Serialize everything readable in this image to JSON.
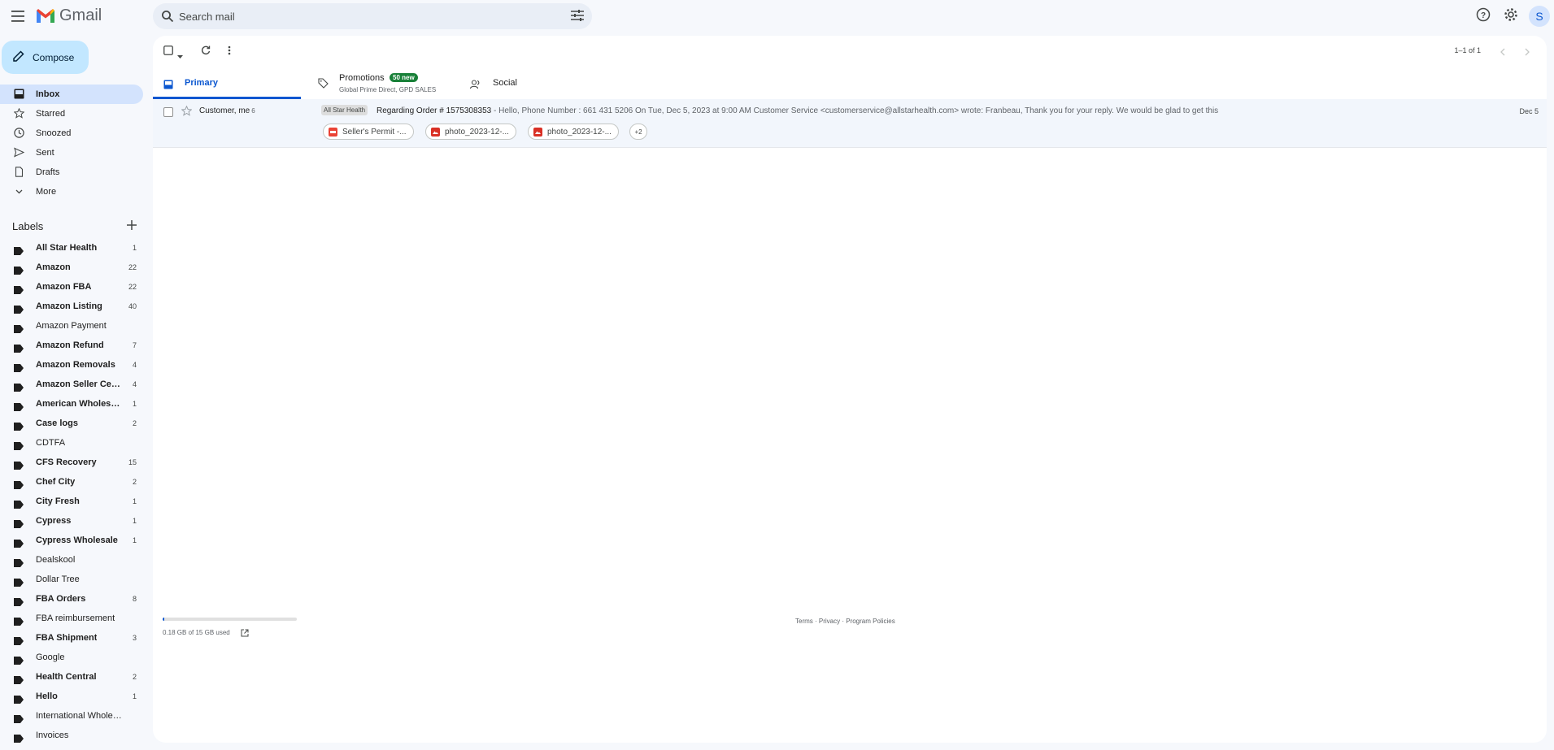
{
  "app": {
    "name": "Gmail"
  },
  "search": {
    "placeholder": "Search mail"
  },
  "header": {
    "avatar_letter": "S"
  },
  "compose": {
    "label": "Compose"
  },
  "nav": [
    {
      "label": "Inbox",
      "icon": "inbox-icon",
      "active": true
    },
    {
      "label": "Starred",
      "icon": "star-icon"
    },
    {
      "label": "Snoozed",
      "icon": "clock-icon"
    },
    {
      "label": "Sent",
      "icon": "send-icon"
    },
    {
      "label": "Drafts",
      "icon": "draft-icon"
    },
    {
      "label": "More",
      "icon": "chevron-down-icon"
    }
  ],
  "labels": {
    "title": "Labels",
    "items": [
      {
        "name": "All Star Health",
        "count": "1",
        "bold": true
      },
      {
        "name": "Amazon",
        "count": "22",
        "bold": true
      },
      {
        "name": "Amazon FBA",
        "count": "22",
        "bold": true
      },
      {
        "name": "Amazon Listing",
        "count": "40",
        "bold": true
      },
      {
        "name": "Amazon Payment",
        "count": "",
        "bold": false
      },
      {
        "name": "Amazon Refund",
        "count": "7",
        "bold": true
      },
      {
        "name": "Amazon Removals",
        "count": "4",
        "bold": true
      },
      {
        "name": "Amazon Seller Cen...",
        "count": "4",
        "bold": true
      },
      {
        "name": "American Wholesal...",
        "count": "1",
        "bold": true
      },
      {
        "name": "Case logs",
        "count": "2",
        "bold": true
      },
      {
        "name": "CDTFA",
        "count": "",
        "bold": false
      },
      {
        "name": "CFS Recovery",
        "count": "15",
        "bold": true
      },
      {
        "name": "Chef City",
        "count": "2",
        "bold": true
      },
      {
        "name": "City Fresh",
        "count": "1",
        "bold": true
      },
      {
        "name": "Cypress",
        "count": "1",
        "bold": true
      },
      {
        "name": "Cypress Wholesale",
        "count": "1",
        "bold": true
      },
      {
        "name": "Dealskool",
        "count": "",
        "bold": false
      },
      {
        "name": "Dollar Tree",
        "count": "",
        "bold": false
      },
      {
        "name": "FBA Orders",
        "count": "8",
        "bold": true
      },
      {
        "name": "FBA reimbursement",
        "count": "",
        "bold": false
      },
      {
        "name": "FBA Shipment",
        "count": "3",
        "bold": true
      },
      {
        "name": "Google",
        "count": "",
        "bold": false
      },
      {
        "name": "Health Central",
        "count": "2",
        "bold": true
      },
      {
        "name": "Hello",
        "count": "1",
        "bold": true
      },
      {
        "name": "International Wholesale",
        "count": "",
        "bold": false
      },
      {
        "name": "Invoices",
        "count": "",
        "bold": false
      }
    ]
  },
  "toolbar": {
    "pager": "1–1 of 1"
  },
  "tabs": {
    "primary": "Primary",
    "promotions": "Promotions",
    "promotions_badge": "50 new",
    "promotions_sub": "Global Prime Direct, GPD SALES",
    "social": "Social"
  },
  "emails": [
    {
      "sender": "Customer, me",
      "count": "6",
      "label": "All Star Health",
      "subject": "Regarding Order # 1575308353",
      "snippet": " - Hello, Phone Number : 661 431 5206 On Tue, Dec 5, 2023 at 9:00 AM Customer Service <customerservice@allstarhealth.com> wrote: Franbeau, Thank you for your reply. We would be glad to get this",
      "date": "Dec 5",
      "attachments": [
        "Seller's Permit -...",
        "photo_2023-12-...",
        "photo_2023-12-..."
      ],
      "more_attachments": "+2"
    }
  ],
  "footer": {
    "storage_text": "0.18 GB of 15 GB used",
    "storage_fraction": 0.012,
    "links": "Terms · Privacy · Program Policies"
  },
  "colors": {
    "accent": "#0b57d0",
    "compose_bg": "#c2e7ff",
    "active_nav": "#d3e3fd",
    "badge_green": "#188038"
  }
}
